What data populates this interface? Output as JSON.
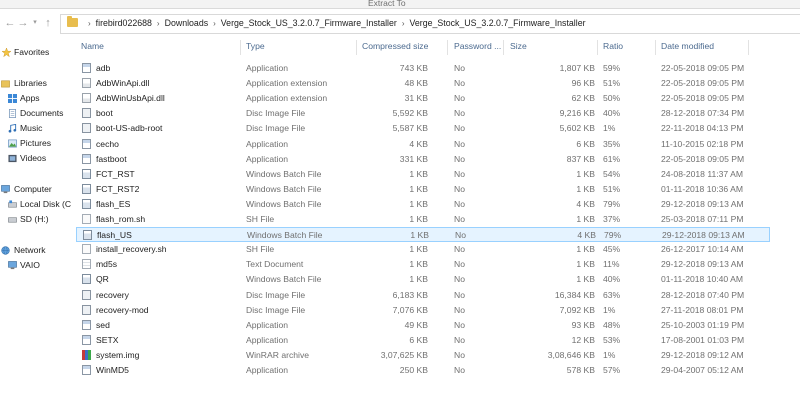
{
  "window": {
    "title": "Extract To"
  },
  "address": {
    "back_icon": "back-arrow-icon",
    "forward_icon": "forward-arrow-icon",
    "recent_icon": "chevron-down-icon",
    "up_icon": "up-arrow-icon",
    "crumbs": [
      "firebird022688",
      "Downloads",
      "Verge_Stock_US_3.2.0.7_Firmware_Installer",
      "Verge_Stock_US_3.2.0.7_Firmware_Installer"
    ]
  },
  "sidebar": {
    "favorites": "Favorites",
    "libraries": "Libraries",
    "apps": "Apps",
    "documents": "Documents",
    "music": "Music",
    "pictures": "Pictures",
    "videos": "Videos",
    "computer": "Computer",
    "local_disk": "Local Disk (C",
    "sd": "SD (H:)",
    "network": "Network",
    "vaio": "VAIO"
  },
  "columns": {
    "name": "Name",
    "type": "Type",
    "compressed": "Compressed size",
    "password": "Password ...",
    "size": "Size",
    "ratio": "Ratio",
    "date": "Date modified"
  },
  "files": [
    {
      "name": "adb",
      "type": "Application",
      "compressed": "743 KB",
      "password": "No",
      "size": "1,807 KB",
      "ratio": "59%",
      "date": "22-05-2018 09:05 PM",
      "icon": "app"
    },
    {
      "name": "AdbWinApi.dll",
      "type": "Application extension",
      "compressed": "48 KB",
      "password": "No",
      "size": "96 KB",
      "ratio": "51%",
      "date": "22-05-2018 09:05 PM",
      "icon": "dll"
    },
    {
      "name": "AdbWinUsbApi.dll",
      "type": "Application extension",
      "compressed": "31 KB",
      "password": "No",
      "size": "62 KB",
      "ratio": "50%",
      "date": "22-05-2018 09:05 PM",
      "icon": "dll"
    },
    {
      "name": "boot",
      "type": "Disc Image File",
      "compressed": "5,592 KB",
      "password": "No",
      "size": "9,216 KB",
      "ratio": "40%",
      "date": "28-12-2018 07:34 PM",
      "icon": "img"
    },
    {
      "name": "boot-US-adb-root",
      "type": "Disc Image File",
      "compressed": "5,587 KB",
      "password": "No",
      "size": "5,602 KB",
      "ratio": "1%",
      "date": "22-11-2018 04:13 PM",
      "icon": "img"
    },
    {
      "name": "cecho",
      "type": "Application",
      "compressed": "4 KB",
      "password": "No",
      "size": "6 KB",
      "ratio": "35%",
      "date": "11-10-2015 02:18 PM",
      "icon": "app"
    },
    {
      "name": "fastboot",
      "type": "Application",
      "compressed": "331 KB",
      "password": "No",
      "size": "837 KB",
      "ratio": "61%",
      "date": "22-05-2018 09:05 PM",
      "icon": "app"
    },
    {
      "name": "FCT_RST",
      "type": "Windows Batch File",
      "compressed": "1 KB",
      "password": "No",
      "size": "1 KB",
      "ratio": "54%",
      "date": "24-08-2018 11:37 AM",
      "icon": "bat"
    },
    {
      "name": "FCT_RST2",
      "type": "Windows Batch File",
      "compressed": "1 KB",
      "password": "No",
      "size": "1 KB",
      "ratio": "51%",
      "date": "01-11-2018 10:36 AM",
      "icon": "bat"
    },
    {
      "name": "flash_ES",
      "type": "Windows Batch File",
      "compressed": "1 KB",
      "password": "No",
      "size": "4 KB",
      "ratio": "79%",
      "date": "29-12-2018 09:13 AM",
      "icon": "bat"
    },
    {
      "name": "flash_rom.sh",
      "type": "SH File",
      "compressed": "1 KB",
      "password": "No",
      "size": "1 KB",
      "ratio": "37%",
      "date": "25-03-2018 07:11 PM",
      "icon": "sh"
    },
    {
      "name": "flash_US",
      "type": "Windows Batch File",
      "compressed": "1 KB",
      "password": "No",
      "size": "4 KB",
      "ratio": "79%",
      "date": "29-12-2018 09:13 AM",
      "icon": "bat",
      "selected": true
    },
    {
      "name": "install_recovery.sh",
      "type": "SH File",
      "compressed": "1 KB",
      "password": "No",
      "size": "1 KB",
      "ratio": "45%",
      "date": "26-12-2017 10:14 AM",
      "icon": "sh"
    },
    {
      "name": "md5s",
      "type": "Text Document",
      "compressed": "1 KB",
      "password": "No",
      "size": "1 KB",
      "ratio": "11%",
      "date": "29-12-2018 09:13 AM",
      "icon": "txt"
    },
    {
      "name": "QR",
      "type": "Windows Batch File",
      "compressed": "1 KB",
      "password": "No",
      "size": "1 KB",
      "ratio": "40%",
      "date": "01-11-2018 10:40 AM",
      "icon": "bat"
    },
    {
      "name": "recovery",
      "type": "Disc Image File",
      "compressed": "6,183 KB",
      "password": "No",
      "size": "16,384 KB",
      "ratio": "63%",
      "date": "28-12-2018 07:40 PM",
      "icon": "img"
    },
    {
      "name": "recovery-mod",
      "type": "Disc Image File",
      "compressed": "7,076 KB",
      "password": "No",
      "size": "7,092 KB",
      "ratio": "1%",
      "date": "27-11-2018 08:01 PM",
      "icon": "img"
    },
    {
      "name": "sed",
      "type": "Application",
      "compressed": "49 KB",
      "password": "No",
      "size": "93 KB",
      "ratio": "48%",
      "date": "25-10-2003 01:19 PM",
      "icon": "app"
    },
    {
      "name": "SETX",
      "type": "Application",
      "compressed": "6 KB",
      "password": "No",
      "size": "12 KB",
      "ratio": "53%",
      "date": "17-08-2001 01:03 PM",
      "icon": "app"
    },
    {
      "name": "system.img",
      "type": "WinRAR archive",
      "compressed": "3,07,625 KB",
      "password": "No",
      "size": "3,08,646 KB",
      "ratio": "1%",
      "date": "29-12-2018 09:12 AM",
      "icon": "rar"
    },
    {
      "name": "WinMD5",
      "type": "Application",
      "compressed": "250 KB",
      "password": "No",
      "size": "578 KB",
      "ratio": "57%",
      "date": "29-04-2007 05:12 AM",
      "icon": "app"
    }
  ]
}
